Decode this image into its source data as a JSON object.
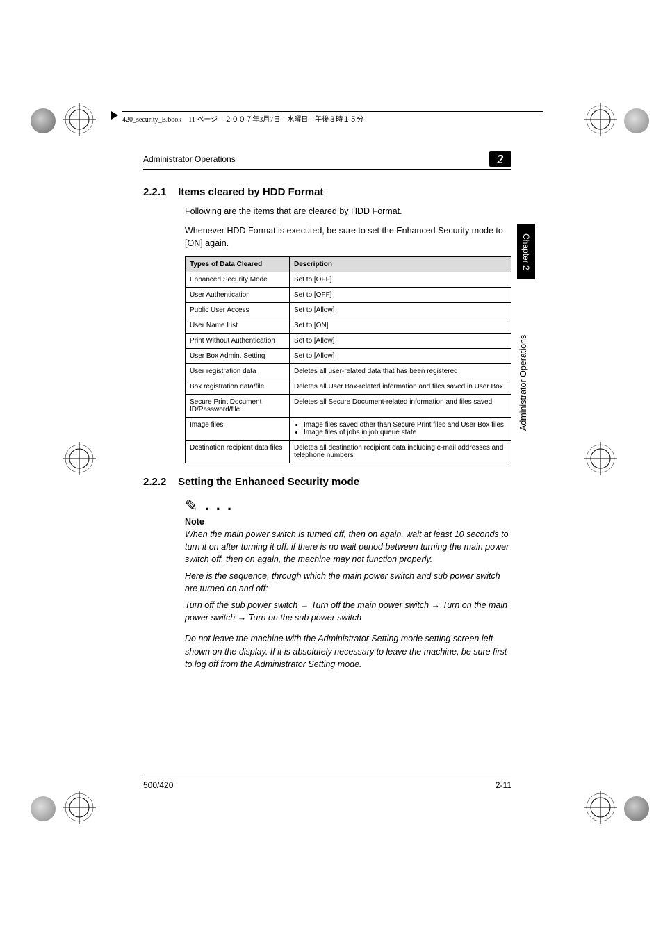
{
  "meta": {
    "top_strip": "420_security_E.book　11 ページ　２００７年3月7日　水曜日　午後３時１５分"
  },
  "header": {
    "running_title": "Administrator Operations",
    "chapter_badge": "2"
  },
  "side": {
    "tab": "Chapter 2",
    "label": "Administrator Operations"
  },
  "section1": {
    "num": "2.2.1",
    "title": "Items cleared by HDD Format",
    "para1": "Following are the items that are cleared by HDD Format.",
    "para2": "Whenever HDD Format is executed, be sure to set the Enhanced Security mode to [ON] again."
  },
  "table": {
    "head": [
      "Types of Data Cleared",
      "Description"
    ],
    "rows": [
      [
        "Enhanced Security Mode",
        "Set to [OFF]"
      ],
      [
        "User Authentication",
        "Set to [OFF]"
      ],
      [
        "Public User Access",
        "Set to [Allow]"
      ],
      [
        "User Name List",
        "Set to [ON]"
      ],
      [
        "Print Without Authentication",
        "Set to [Allow]"
      ],
      [
        "User Box Admin. Setting",
        "Set to [Allow]"
      ],
      [
        "User registration data",
        "Deletes all user-related data that has been registered"
      ],
      [
        "Box registration data/file",
        "Deletes all User Box-related information and files saved in User Box"
      ],
      [
        "Secure Print Document ID/Password/file",
        "Deletes all Secure Document-related information and files saved"
      ]
    ],
    "image_files_label": "Image files",
    "image_files_items": [
      "Image files saved other than Secure Print files and User Box files",
      "Image files of jobs in job queue state"
    ],
    "last_row": [
      "Destination recipient data files",
      "Deletes all destination recipient data including e-mail addresses and telephone numbers"
    ]
  },
  "section2": {
    "num": "2.2.2",
    "title": "Setting the Enhanced Security mode",
    "note_label": "Note",
    "note_p1": "When the main power switch is turned off, then on again, wait at least 10 seconds to turn it on after turning it off. if there is no wait period between turning the main power switch off, then on again, the machine may not function properly.",
    "note_p2": "Here is the sequence, through which the main power switch and sub power switch are turned on and off:",
    "note_p3": "Turn off the sub power switch → Turn off the main power switch → Turn on the main power switch → Turn on the sub power switch",
    "note_p4": "Do not leave the machine with the Administrator Setting mode setting screen left shown on the display. If it is absolutely necessary to leave the machine, be sure first to log off from the Administrator Setting mode."
  },
  "footer": {
    "left": "500/420",
    "right": "2-11"
  }
}
